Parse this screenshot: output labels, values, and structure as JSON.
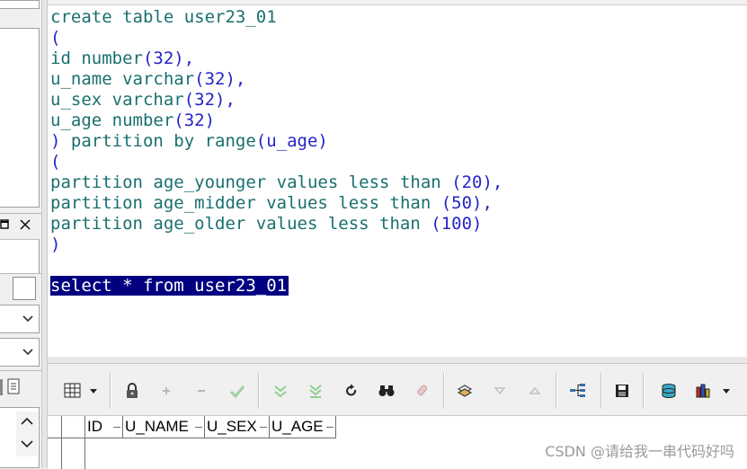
{
  "editor": {
    "lines": [
      [
        {
          "t": "create table ",
          "c": "kw"
        },
        {
          "t": "user23_01",
          "c": "id"
        }
      ],
      [
        {
          "t": "(",
          "c": "pn"
        }
      ],
      [
        {
          "t": "id ",
          "c": "id"
        },
        {
          "t": "number",
          "c": "kw"
        },
        {
          "t": "(32),",
          "c": "num"
        }
      ],
      [
        {
          "t": "u_name ",
          "c": "id"
        },
        {
          "t": "varchar",
          "c": "kw"
        },
        {
          "t": "(32),",
          "c": "num"
        }
      ],
      [
        {
          "t": "u_sex ",
          "c": "id"
        },
        {
          "t": "varchar",
          "c": "kw"
        },
        {
          "t": "(32),",
          "c": "num"
        }
      ],
      [
        {
          "t": "u_age ",
          "c": "id"
        },
        {
          "t": "number",
          "c": "kw"
        },
        {
          "t": "(32)",
          "c": "num"
        }
      ],
      [
        {
          "t": ") ",
          "c": "pn"
        },
        {
          "t": "partition by range",
          "c": "kw"
        },
        {
          "t": "(u_age)",
          "c": "num"
        }
      ],
      [
        {
          "t": "(",
          "c": "pn"
        }
      ],
      [
        {
          "t": "partition ",
          "c": "kw"
        },
        {
          "t": "age_younger ",
          "c": "id"
        },
        {
          "t": "values less than ",
          "c": "kw"
        },
        {
          "t": "(20),",
          "c": "num"
        }
      ],
      [
        {
          "t": "partition ",
          "c": "kw"
        },
        {
          "t": "age_midder ",
          "c": "id"
        },
        {
          "t": "values less than ",
          "c": "kw"
        },
        {
          "t": "(50),",
          "c": "num"
        }
      ],
      [
        {
          "t": "partition ",
          "c": "kw"
        },
        {
          "t": "age_older ",
          "c": "id"
        },
        {
          "t": "values less than ",
          "c": "kw"
        },
        {
          "t": "(100)",
          "c": "num"
        }
      ],
      [
        {
          "t": ")",
          "c": "pn"
        }
      ],
      [],
      [
        {
          "t": "select * from user23_01",
          "c": "sel"
        }
      ]
    ]
  },
  "grid": {
    "columns": [
      "ID",
      "U_NAME",
      "U_SEX",
      "U_AGE"
    ]
  },
  "toolbar": {
    "buttons": [
      {
        "name": "grid-view-icon"
      },
      {
        "name": "lock-icon"
      },
      {
        "name": "add-record-icon"
      },
      {
        "name": "delete-record-icon"
      },
      {
        "name": "post-edit-icon"
      },
      {
        "name": "fetch-next-page-icon"
      },
      {
        "name": "fetch-last-page-icon"
      },
      {
        "name": "refresh-icon"
      },
      {
        "name": "find-icon"
      },
      {
        "name": "clear-icon"
      },
      {
        "name": "query-by-example-icon"
      },
      {
        "name": "sort-descending-icon"
      },
      {
        "name": "sort-ascending-icon"
      },
      {
        "name": "export-tree-icon"
      },
      {
        "name": "save-icon"
      },
      {
        "name": "database-icon"
      },
      {
        "name": "chart-icon"
      }
    ]
  },
  "watermark": "CSDN @请给我一串代码好吗",
  "colors": {
    "keyword": "#1a6f6f",
    "number": "#2424c8",
    "selection": "#000080"
  }
}
